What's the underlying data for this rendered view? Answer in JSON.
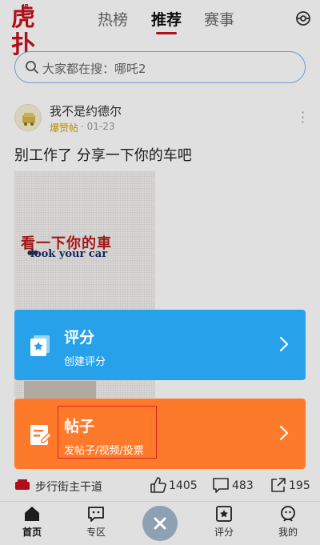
{
  "header": {
    "logo_text": "虎扑",
    "logo_small": "JR",
    "tabs": [
      {
        "label": "热榜",
        "active": false
      },
      {
        "label": "推荐",
        "active": true
      },
      {
        "label": "赛事",
        "active": false
      }
    ]
  },
  "search": {
    "placeholder": "大家都在搜：哪吒2"
  },
  "post": {
    "author": "我不是约德尔",
    "badge": "爆赞帖",
    "date": "· 01-23",
    "title": "别工作了 分享一下你的车吧",
    "image_text_cn": "看一下你的車",
    "image_text_en": "look your car",
    "footer_source": "步行街主干道",
    "likes": "1405",
    "comments": "483",
    "shares": "195"
  },
  "action_sheet": {
    "items": [
      {
        "title": "评分",
        "subtitle": "创建评分",
        "color": "#27a1ea"
      },
      {
        "title": "帖子",
        "subtitle": "发帖子/视频/投票",
        "color": "#fe7a2b"
      }
    ]
  },
  "tabbar": {
    "items": [
      {
        "label": "首页",
        "icon": "home-icon"
      },
      {
        "label": "专区",
        "icon": "zone-icon"
      },
      {
        "label": "评分",
        "icon": "rating-icon"
      },
      {
        "label": "我的",
        "icon": "profile-icon"
      }
    ],
    "close_icon": "close-icon"
  },
  "colors": {
    "brand_red": "#c8101e",
    "accent_blue": "#27a1ea",
    "accent_orange": "#fe7a2b"
  }
}
